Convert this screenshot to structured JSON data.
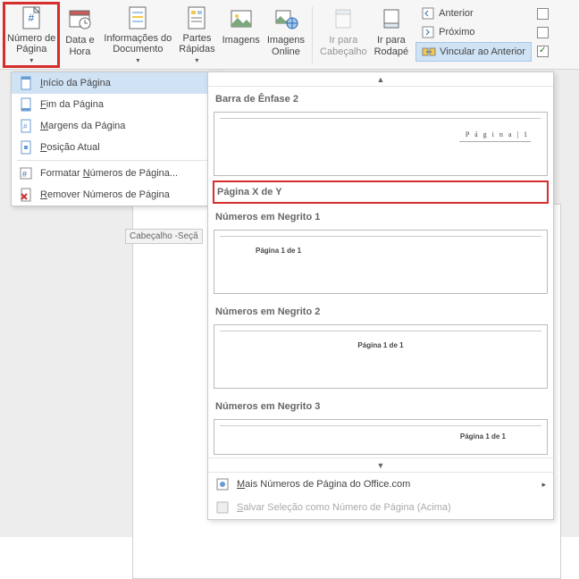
{
  "ribbon": {
    "numero_pagina": "Número de\nPágina",
    "data_hora": "Data e\nHora",
    "info_doc": "Informações do\nDocumento",
    "partes_rapidas": "Partes\nRápidas",
    "imagens": "Imagens",
    "imagens_online": "Imagens\nOnline",
    "ir_cabecalho": "Ir para\nCabeçalho",
    "ir_rodape": "Ir para\nRodapé",
    "anterior": "Anterior",
    "proximo": "Próximo",
    "vincular_anterior": "Vincular ao Anterior"
  },
  "menu": {
    "inicio_pagina": "Início da Página",
    "fim_pagina": "Fim da Página",
    "margens_pagina": "Margens da Página",
    "posicao_atual": "Posição Atual",
    "formatar": "Formatar Números de Página...",
    "remover": "Remover Números de Página"
  },
  "submenu": {
    "cat_enfase": "Barra de Ênfase 2",
    "enfase_text": "P á g i n a | 1",
    "cat_xdey": "Página X de Y",
    "cat_negrito1": "Números em Negrito 1",
    "neg1_text": "Página 1 de 1",
    "cat_negrito2": "Números em Negrito 2",
    "neg2_text": "Página 1 de 1",
    "cat_negrito3": "Números em Negrito 3",
    "neg3_text": "Página 1 de 1",
    "mais_office": "Mais Números de Página do Office.com",
    "salvar_selecao": "Salvar Seleção como Número de Página (Acima)"
  },
  "doc": {
    "header_tag": "Cabeçalho -Seçã"
  },
  "icons": {
    "page_number": "page-number-icon",
    "date": "date-icon",
    "info": "info-icon",
    "quickparts": "quickparts-icon",
    "images": "images-icon",
    "images_online": "images-online-icon",
    "go_header": "go-header-icon",
    "go_footer": "go-footer-icon",
    "prev": "prev-icon",
    "next": "next-icon",
    "link": "link-icon"
  }
}
